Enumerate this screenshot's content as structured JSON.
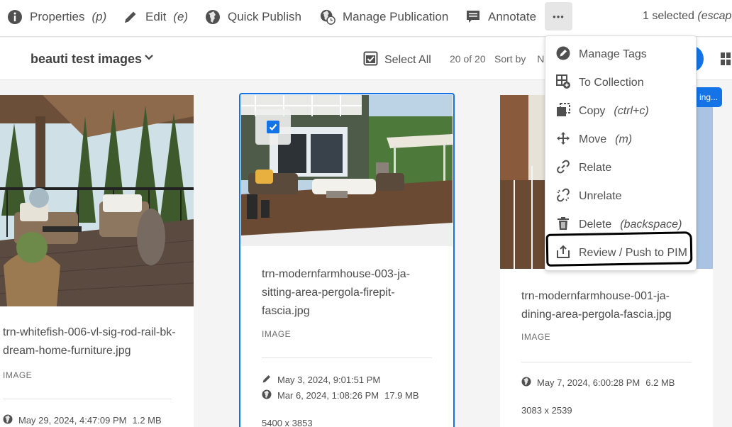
{
  "toolbar": {
    "properties": {
      "label": "Properties",
      "shortcut": "(p)"
    },
    "edit": {
      "label": "Edit",
      "shortcut": "(e)"
    },
    "quick_publish": "Quick Publish",
    "manage_publication": "Manage Publication",
    "annotate": "Annotate",
    "more_label": "•••",
    "selected": {
      "label": "1 selected",
      "shortcut": "(escape"
    }
  },
  "subbar": {
    "folder": "beauti test images",
    "select_all": "Select All",
    "count": "20 of 20",
    "sort_by": "Sort by",
    "sort_partial": "N"
  },
  "menu": {
    "items": [
      {
        "label": "Manage Tags",
        "shortcut": "",
        "icon": "tag-icon"
      },
      {
        "label": "To Collection",
        "shortcut": "",
        "icon": "collection-add-icon"
      },
      {
        "label": "Copy",
        "shortcut": "(ctrl+c)",
        "icon": "copy-icon"
      },
      {
        "label": "Move",
        "shortcut": "(m)",
        "icon": "move-icon"
      },
      {
        "label": "Relate",
        "shortcut": "",
        "icon": "link-icon"
      },
      {
        "label": "Unrelate",
        "shortcut": "",
        "icon": "unlink-icon"
      },
      {
        "label": "Delete",
        "shortcut": "(backspace)",
        "icon": "trash-icon"
      },
      {
        "label": "Review / Push to PIM",
        "shortcut": "",
        "icon": "share-icon"
      }
    ]
  },
  "cards": [
    {
      "name": "trn-whitefish-006-vl-sig-rod-rail-bk-dream-home-furniture.jpg",
      "type": "IMAGE",
      "published": "May 29, 2024, 4:47:09 PM",
      "size": "1.2 MB"
    },
    {
      "name": "trn-modernfarmhouse-003-ja-sitting-area-pergola-firepit-fascia.jpg",
      "type": "IMAGE",
      "modified": "May 3, 2024, 9:01:51 PM",
      "published": "Mar 6, 2024, 1:08:26 PM",
      "size": "17.9 MB",
      "dimensions": "5400 x 3853",
      "selected": true
    },
    {
      "name": "trn-modernfarmhouse-001-ja-dining-area-pergola-fascia.jpg",
      "type": "IMAGE",
      "published": "May 7, 2024, 6:00:28 PM",
      "size": "6.2 MB",
      "dimensions": "3083 x 2539",
      "badge": "ing..."
    }
  ],
  "colors": {
    "accent": "#1473e6",
    "text": "#4b4b4b",
    "menu_hover": "#e6e6e6"
  }
}
